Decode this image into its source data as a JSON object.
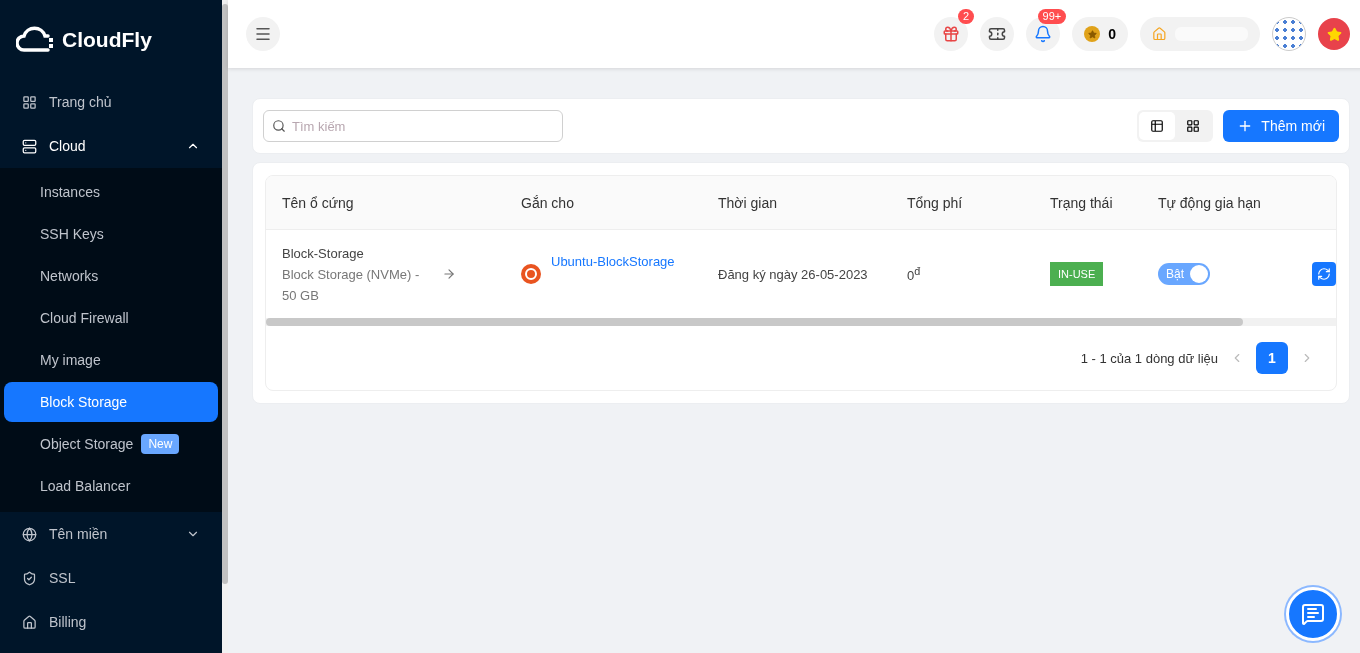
{
  "brand": {
    "name": "CloudFly"
  },
  "sidebar": {
    "items": [
      {
        "kind": "top",
        "label": "Trang chủ",
        "selected": false
      },
      {
        "kind": "top",
        "label": "Cloud",
        "expanded": true,
        "selected": false,
        "children": [
          {
            "label": "Instances",
            "selected": false
          },
          {
            "label": "SSH Keys",
            "selected": false
          },
          {
            "label": "Networks",
            "selected": false
          },
          {
            "label": "Cloud Firewall",
            "selected": false
          },
          {
            "label": "My image",
            "selected": false
          },
          {
            "label": "Block Storage",
            "selected": true
          },
          {
            "label": "Object Storage",
            "selected": false,
            "badge": "New"
          },
          {
            "label": "Load Balancer",
            "selected": false
          }
        ]
      },
      {
        "kind": "top",
        "label": "Tên miền",
        "expanded": false,
        "selected": false
      },
      {
        "kind": "top",
        "label": "SSL",
        "selected": false
      },
      {
        "kind": "top",
        "label": "Billing",
        "selected": false
      }
    ]
  },
  "header": {
    "gift_badge": "2",
    "notification_badge": "99+",
    "coins": "0"
  },
  "toolbar": {
    "search": {
      "placeholder": "Tìm kiếm"
    },
    "views": [
      {
        "kind": "table",
        "selected": true
      },
      {
        "kind": "grid",
        "selected": false
      }
    ],
    "add_button": "Thêm mới"
  },
  "table": {
    "columns": [
      "Tên ổ cứng",
      "Gắn cho",
      "Thời gian",
      "Tổng phí",
      "Trạng thái",
      "Tự động gia hạn"
    ],
    "rows": [
      {
        "name": "Block-Storage",
        "spec": "Block Storage (NVMe) - 50 GB",
        "attached_to": "Ubuntu-BlockStorage",
        "time": "Đăng ký ngày 26-05-2023",
        "cost": "0$^{đ}$",
        "status": "IN-USE",
        "auto_renew": {
          "label": "Bật",
          "on": true
        }
      }
    ]
  },
  "pagination": {
    "summary": "1 - 1 của 1 dòng dữ liệu",
    "pages": [
      {
        "label": "1",
        "selected": true
      }
    ]
  }
}
